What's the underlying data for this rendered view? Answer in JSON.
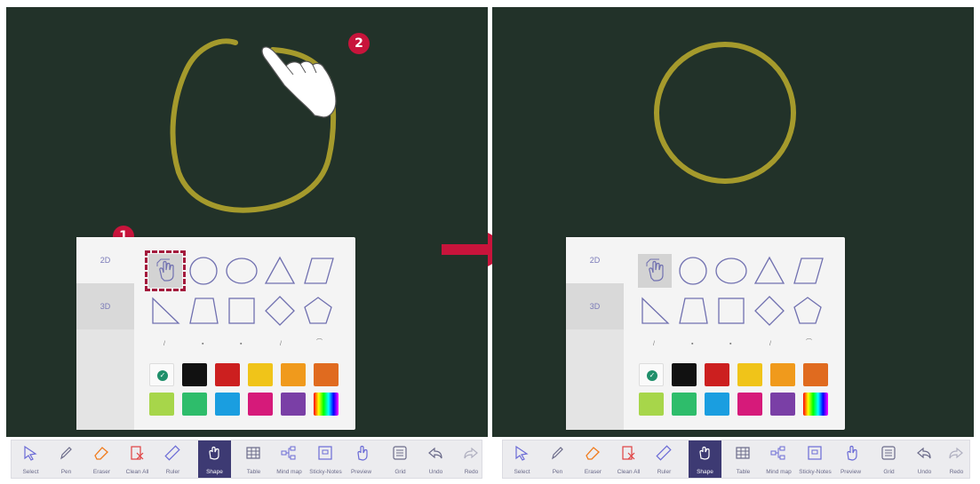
{
  "markers": {
    "step1": "1",
    "step2": "2"
  },
  "shape_panel": {
    "tab_2d": "2D",
    "tab_3d": "3D",
    "shapes_row1": [
      "pointer-hand-icon",
      "circle-icon",
      "ellipse-icon",
      "triangle-icon",
      "parallelogram-icon"
    ],
    "shapes_row2": [
      "right-triangle-icon",
      "trapezoid-icon",
      "square-icon",
      "diamond-icon",
      "pentagon-icon"
    ],
    "colors": [
      "#fafafa",
      "#111111",
      "#cc1f1f",
      "#f0c419",
      "#f09a1c",
      "#e06b1f",
      "#a7d64a",
      "#2ebd6b",
      "#1a9ee0",
      "#d61a7a",
      "#7a3fa6",
      "gradient"
    ]
  },
  "toolbar": {
    "items": [
      {
        "label": "Select",
        "icon": "select-cursor-icon"
      },
      {
        "label": "Pen",
        "icon": "pen-icon"
      },
      {
        "label": "Eraser",
        "icon": "eraser-icon"
      },
      {
        "label": "Clean All",
        "icon": "clean-all-icon"
      },
      {
        "label": "Ruler",
        "icon": "ruler-icon"
      },
      {
        "label": "Shape",
        "icon": "shape-icon"
      },
      {
        "label": "Table",
        "icon": "table-icon"
      },
      {
        "label": "Mind map",
        "icon": "mind-map-icon"
      },
      {
        "label": "Sticky-Notes",
        "icon": "sticky-notes-icon"
      },
      {
        "label": "Preview",
        "icon": "preview-icon"
      },
      {
        "label": "Grid",
        "icon": "grid-icon"
      },
      {
        "label": "Undo",
        "icon": "undo-icon"
      },
      {
        "label": "Redo",
        "icon": "redo-icon"
      }
    ],
    "active": "Shape"
  },
  "colors": {
    "board": "#223229",
    "stroke": "#a59a2c",
    "marker": "#c8143b",
    "toolbar_active": "#3d3a73",
    "arrow": "#c8143b"
  }
}
